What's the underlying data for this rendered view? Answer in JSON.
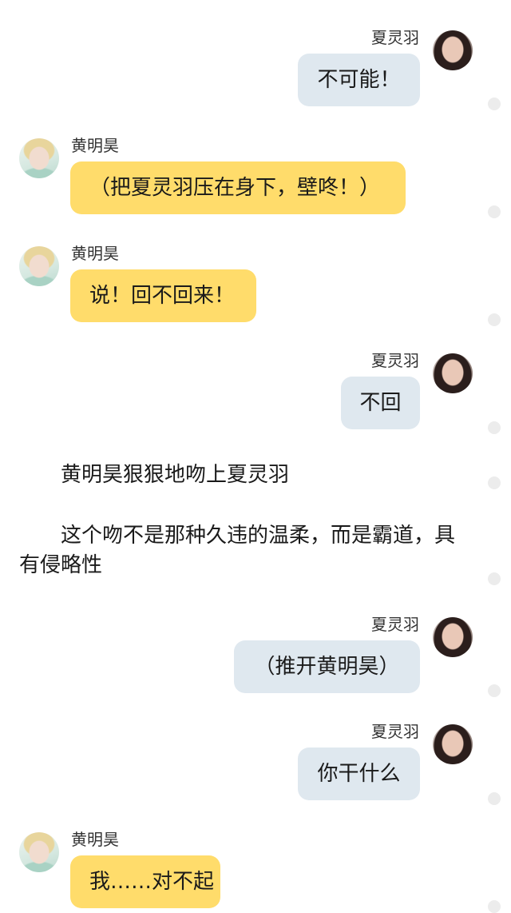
{
  "messages": [
    {
      "side": "right",
      "sender": "夏灵羽",
      "text": "不可能！"
    },
    {
      "side": "left",
      "sender": "黄明昊",
      "text": "（把夏灵羽压在身下，壁咚！）"
    },
    {
      "side": "left",
      "sender": "黄明昊",
      "text": "说！回不回来！"
    },
    {
      "side": "right",
      "sender": "夏灵羽",
      "text": "不回"
    },
    {
      "side": "right",
      "sender": "夏灵羽",
      "text": "（推开黄明昊）"
    },
    {
      "side": "right",
      "sender": "夏灵羽",
      "text": "你干什么"
    },
    {
      "side": "left",
      "sender": "黄明昊",
      "text": "我……对不起"
    }
  ],
  "narration": [
    "黄明昊狠狠地吻上夏灵羽",
    "这个吻不是那种久违的温柔，而是霸道，具有侵略性"
  ],
  "colors": {
    "right_bubble": "#dfe8ef",
    "left_bubble": "#ffdc6b",
    "scroll_dot": "#ececec"
  }
}
